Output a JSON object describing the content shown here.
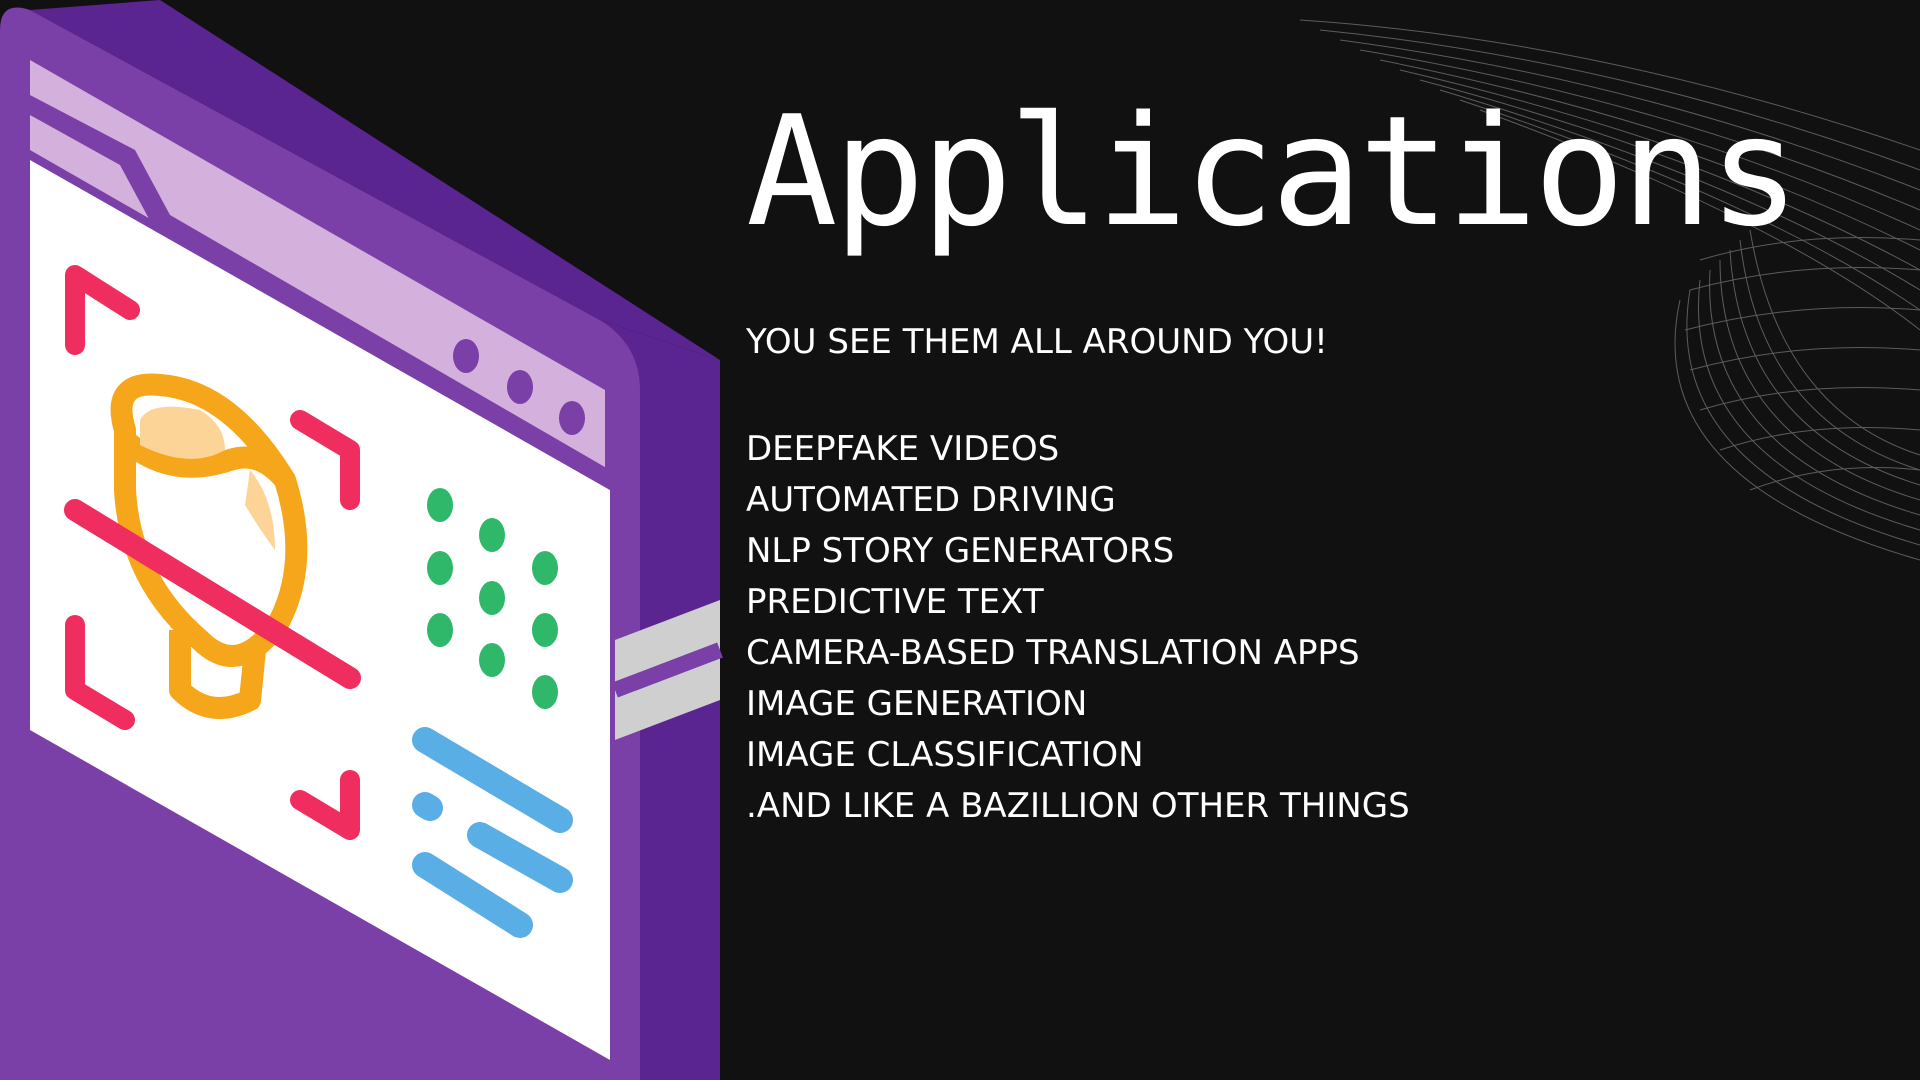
{
  "slide": {
    "title": "Applications",
    "subtitle": "YOU SEE THEM ALL AROUND YOU!",
    "items": [
      "DEEPFAKE VIDEOS",
      "AUTOMATED DRIVING",
      "NLP STORY GENERATORS",
      "PREDICTIVE TEXT",
      "CAMERA-BASED TRANSLATION APPS",
      "IMAGE GENERATION",
      "IMAGE CLASSIFICATION",
      ".AND LIKE A BAZILLION OTHER THINGS"
    ]
  },
  "colors": {
    "background": "#111111",
    "frame_purple": "#7b3fa8",
    "frame_dark": "#5a2590",
    "header_lilac": "#d4b0dc",
    "face_orange": "#f5a61b",
    "bracket_pink": "#ef2d5e",
    "dots_green": "#2fb86a",
    "lines_blue": "#5aaee6"
  },
  "icons": [
    "face-recognition-browser-illustration",
    "wave-mesh-decoration"
  ]
}
